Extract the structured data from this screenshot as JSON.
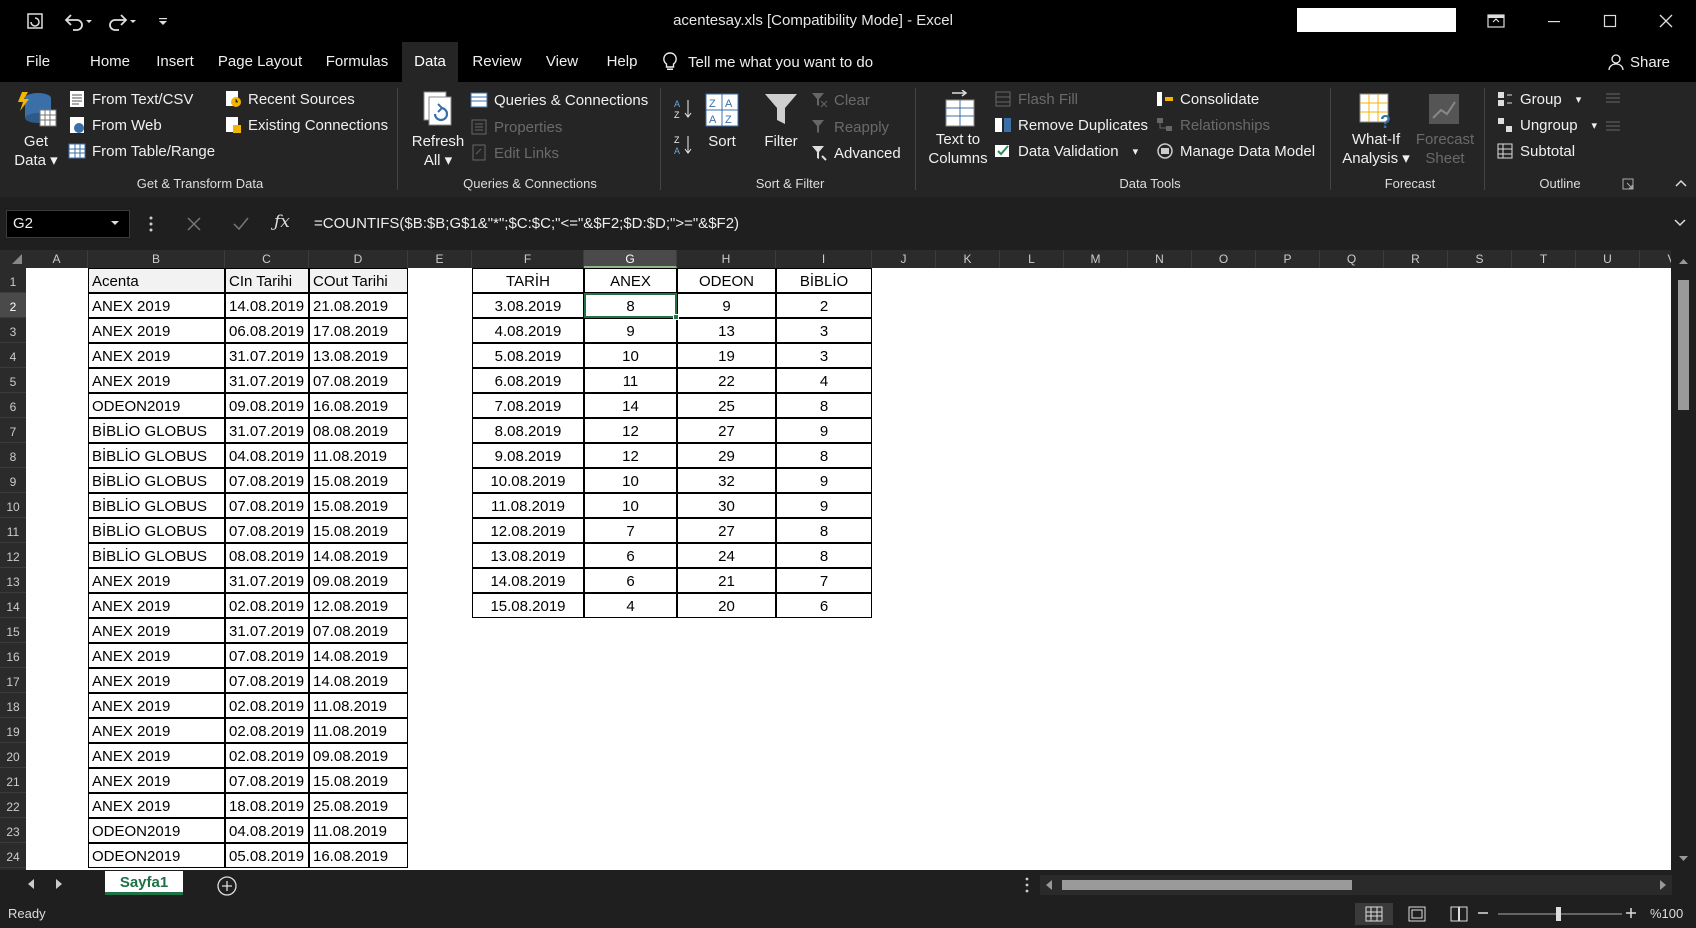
{
  "window": {
    "title": "acentesay.xls  [Compatibility Mode]  -  Excel"
  },
  "tabs": [
    "File",
    "Home",
    "Insert",
    "Page Layout",
    "Formulas",
    "Data",
    "Review",
    "View",
    "Help"
  ],
  "active_tab": "Data",
  "tell_me": "Tell me what you want to do",
  "share": "Share",
  "ribbon": {
    "get_data": {
      "line1": "Get",
      "line2": "Data"
    },
    "from_text_csv": "From Text/CSV",
    "from_web": "From Web",
    "from_table_range": "From Table/Range",
    "recent_sources": "Recent Sources",
    "existing_connections": "Existing Connections",
    "group_get_transform": "Get & Transform Data",
    "refresh_all": {
      "line1": "Refresh",
      "line2": "All"
    },
    "queries_connections": "Queries & Connections",
    "properties": "Properties",
    "edit_links": "Edit Links",
    "group_queries": "Queries & Connections",
    "sort": "Sort",
    "filter": "Filter",
    "clear": "Clear",
    "reapply": "Reapply",
    "advanced": "Advanced",
    "group_sort_filter": "Sort & Filter",
    "text_to_columns": {
      "line1": "Text to",
      "line2": "Columns"
    },
    "flash_fill": "Flash Fill",
    "remove_duplicates": "Remove Duplicates",
    "data_validation": "Data Validation",
    "consolidate": "Consolidate",
    "relationships": "Relationships",
    "manage_data_model": "Manage Data Model",
    "group_data_tools": "Data Tools",
    "what_if": {
      "line1": "What-If",
      "line2": "Analysis"
    },
    "forecast_sheet": {
      "line1": "Forecast",
      "line2": "Sheet"
    },
    "group_forecast": "Forecast",
    "group": "Group",
    "ungroup": "Ungroup",
    "subtotal": "Subtotal",
    "group_outline": "Outline"
  },
  "formula_bar": {
    "name_box": "G2",
    "formula": "=COUNTIFS($B:$B;G$1&\"*\";$C:$C;\"<=\"&$F2;$D:$D;\">=\"&$F2)"
  },
  "columns": [
    "A",
    "B",
    "C",
    "D",
    "E",
    "F",
    "G",
    "H",
    "I",
    "J",
    "K",
    "L",
    "M",
    "N",
    "O",
    "P",
    "Q",
    "R",
    "S",
    "T",
    "U",
    "V"
  ],
  "rows": [
    "1",
    "2",
    "3",
    "4",
    "5",
    "6",
    "7",
    "8",
    "9",
    "10",
    "11",
    "12",
    "13",
    "14",
    "15",
    "16",
    "17",
    "18",
    "19",
    "20",
    "21",
    "22",
    "23",
    "24"
  ],
  "left_table": {
    "headers": [
      "Acenta",
      "CIn Tarihi",
      "COut Tarihi"
    ],
    "rows": [
      [
        "ANEX 2019",
        "14.08.2019",
        "21.08.2019"
      ],
      [
        "ANEX 2019",
        "06.08.2019",
        "17.08.2019"
      ],
      [
        "ANEX 2019",
        "31.07.2019",
        "13.08.2019"
      ],
      [
        "ANEX 2019",
        "31.07.2019",
        "07.08.2019"
      ],
      [
        "ODEON2019",
        "09.08.2019",
        "16.08.2019"
      ],
      [
        "BİBLİO GLOBUS",
        "31.07.2019",
        "08.08.2019"
      ],
      [
        "BİBLİO GLOBUS",
        "04.08.2019",
        "11.08.2019"
      ],
      [
        "BİBLİO GLOBUS",
        "07.08.2019",
        "15.08.2019"
      ],
      [
        "BİBLİO GLOBUS",
        "07.08.2019",
        "15.08.2019"
      ],
      [
        "BİBLİO GLOBUS",
        "07.08.2019",
        "15.08.2019"
      ],
      [
        "BİBLİO GLOBUS",
        "08.08.2019",
        "14.08.2019"
      ],
      [
        "ANEX 2019",
        "31.07.2019",
        "09.08.2019"
      ],
      [
        "ANEX 2019",
        "02.08.2019",
        "12.08.2019"
      ],
      [
        "ANEX 2019",
        "31.07.2019",
        "07.08.2019"
      ],
      [
        "ANEX 2019",
        "07.08.2019",
        "14.08.2019"
      ],
      [
        "ANEX 2019",
        "07.08.2019",
        "14.08.2019"
      ],
      [
        "ANEX 2019",
        "02.08.2019",
        "11.08.2019"
      ],
      [
        "ANEX 2019",
        "02.08.2019",
        "11.08.2019"
      ],
      [
        "ANEX 2019",
        "02.08.2019",
        "09.08.2019"
      ],
      [
        "ANEX 2019",
        "07.08.2019",
        "15.08.2019"
      ],
      [
        "ANEX 2019",
        "18.08.2019",
        "25.08.2019"
      ],
      [
        "ODEON2019",
        "04.08.2019",
        "11.08.2019"
      ],
      [
        "ODEON2019",
        "05.08.2019",
        "16.08.2019"
      ]
    ]
  },
  "right_table": {
    "headers": [
      "TARİH",
      "ANEX",
      "ODEON",
      "BİBLİO"
    ],
    "rows": [
      [
        "3.08.2019",
        "8",
        "9",
        "2"
      ],
      [
        "4.08.2019",
        "9",
        "13",
        "3"
      ],
      [
        "5.08.2019",
        "10",
        "19",
        "3"
      ],
      [
        "6.08.2019",
        "11",
        "22",
        "4"
      ],
      [
        "7.08.2019",
        "14",
        "25",
        "8"
      ],
      [
        "8.08.2019",
        "12",
        "27",
        "9"
      ],
      [
        "9.08.2019",
        "12",
        "29",
        "8"
      ],
      [
        "10.08.2019",
        "10",
        "32",
        "9"
      ],
      [
        "11.08.2019",
        "10",
        "30",
        "9"
      ],
      [
        "12.08.2019",
        "7",
        "27",
        "8"
      ],
      [
        "13.08.2019",
        "6",
        "24",
        "8"
      ],
      [
        "14.08.2019",
        "6",
        "21",
        "7"
      ],
      [
        "15.08.2019",
        "4",
        "20",
        "6"
      ]
    ]
  },
  "sheet_tab": "Sayfa1",
  "status": {
    "ready": "Ready",
    "zoom": "%100"
  },
  "colors": {
    "accent_green": "#1e7145",
    "selection_green": "#217346"
  }
}
